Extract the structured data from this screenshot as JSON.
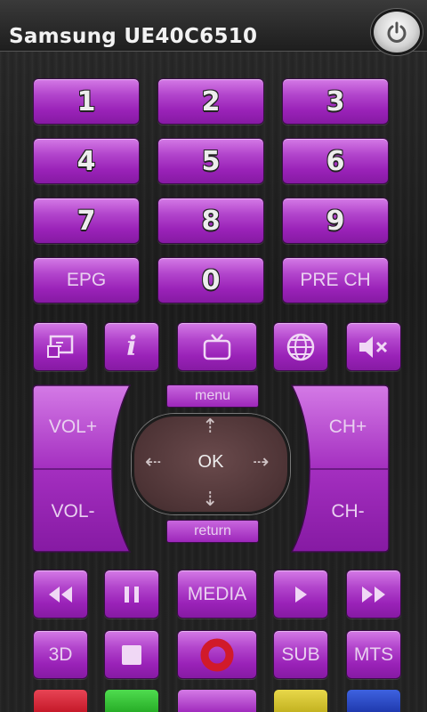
{
  "app": {
    "title": "Samsung UE40C6510"
  },
  "numpad": [
    {
      "label": "1",
      "name": "digit-1-button"
    },
    {
      "label": "2",
      "name": "digit-2-button"
    },
    {
      "label": "3",
      "name": "digit-3-button"
    },
    {
      "label": "4",
      "name": "digit-4-button"
    },
    {
      "label": "5",
      "name": "digit-5-button"
    },
    {
      "label": "6",
      "name": "digit-6-button"
    },
    {
      "label": "7",
      "name": "digit-7-button"
    },
    {
      "label": "8",
      "name": "digit-8-button"
    },
    {
      "label": "9",
      "name": "digit-9-button"
    },
    {
      "label": "EPG",
      "name": "epg-button"
    },
    {
      "label": "0",
      "name": "digit-0-button"
    },
    {
      "label": "PRE CH",
      "name": "pre-ch-button"
    }
  ],
  "icon_row": [
    "source-icon",
    "info-icon",
    "tv-icon",
    "internet-icon",
    "mute-icon"
  ],
  "volume": {
    "up": "VOL+",
    "down": "VOL-"
  },
  "channel": {
    "up": "CH+",
    "down": "CH-"
  },
  "nav": {
    "menu": "menu",
    "return": "return",
    "ok": "OK"
  },
  "playback": {
    "media": "MEDIA",
    "icons": [
      "rewind-icon",
      "pause-icon",
      "play-icon",
      "fast-forward-icon"
    ]
  },
  "bottom": {
    "label_3d": "3D",
    "sub": "SUB",
    "mts": "MTS",
    "icons": [
      "stop-icon",
      "record-icon"
    ]
  },
  "color_keys": [
    {
      "name": "red-key",
      "color": "#d41a2e"
    },
    {
      "name": "green-key",
      "color": "#2dbf2d"
    },
    {
      "name": "purple-key",
      "color": "#b245cc"
    },
    {
      "name": "yellow-key",
      "color": "#d6c330"
    },
    {
      "name": "blue-key",
      "color": "#2344c4"
    }
  ],
  "colors": {
    "accent": "#b245cc",
    "background": "#222222"
  }
}
